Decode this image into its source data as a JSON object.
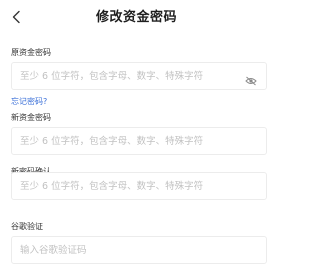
{
  "header": {
    "title": "修改资金密码"
  },
  "form": {
    "old_password": {
      "label": "原资金密码",
      "placeholder": "至少 6 位字符，包含字母、数字、特殊字符",
      "value": ""
    },
    "forgot_link": "忘记密码?",
    "new_password": {
      "label": "新资金密码",
      "placeholder": "至少 6 位字符，包含字母、数字、特殊字符",
      "value": ""
    },
    "confirm_password": {
      "label": "新密码确认",
      "placeholder": "至少 6 位字符，包含字母、数字、特殊字符",
      "value": ""
    },
    "google_code": {
      "label": "谷歌验证",
      "placeholder": "输入谷歌验证码",
      "value": ""
    }
  },
  "icons": {
    "back": "chevron-left-icon",
    "password_visibility": "eye-off-icon"
  },
  "colors": {
    "link": "#3a6fd8",
    "placeholder": "#c2c2c2",
    "border": "#ececec"
  }
}
